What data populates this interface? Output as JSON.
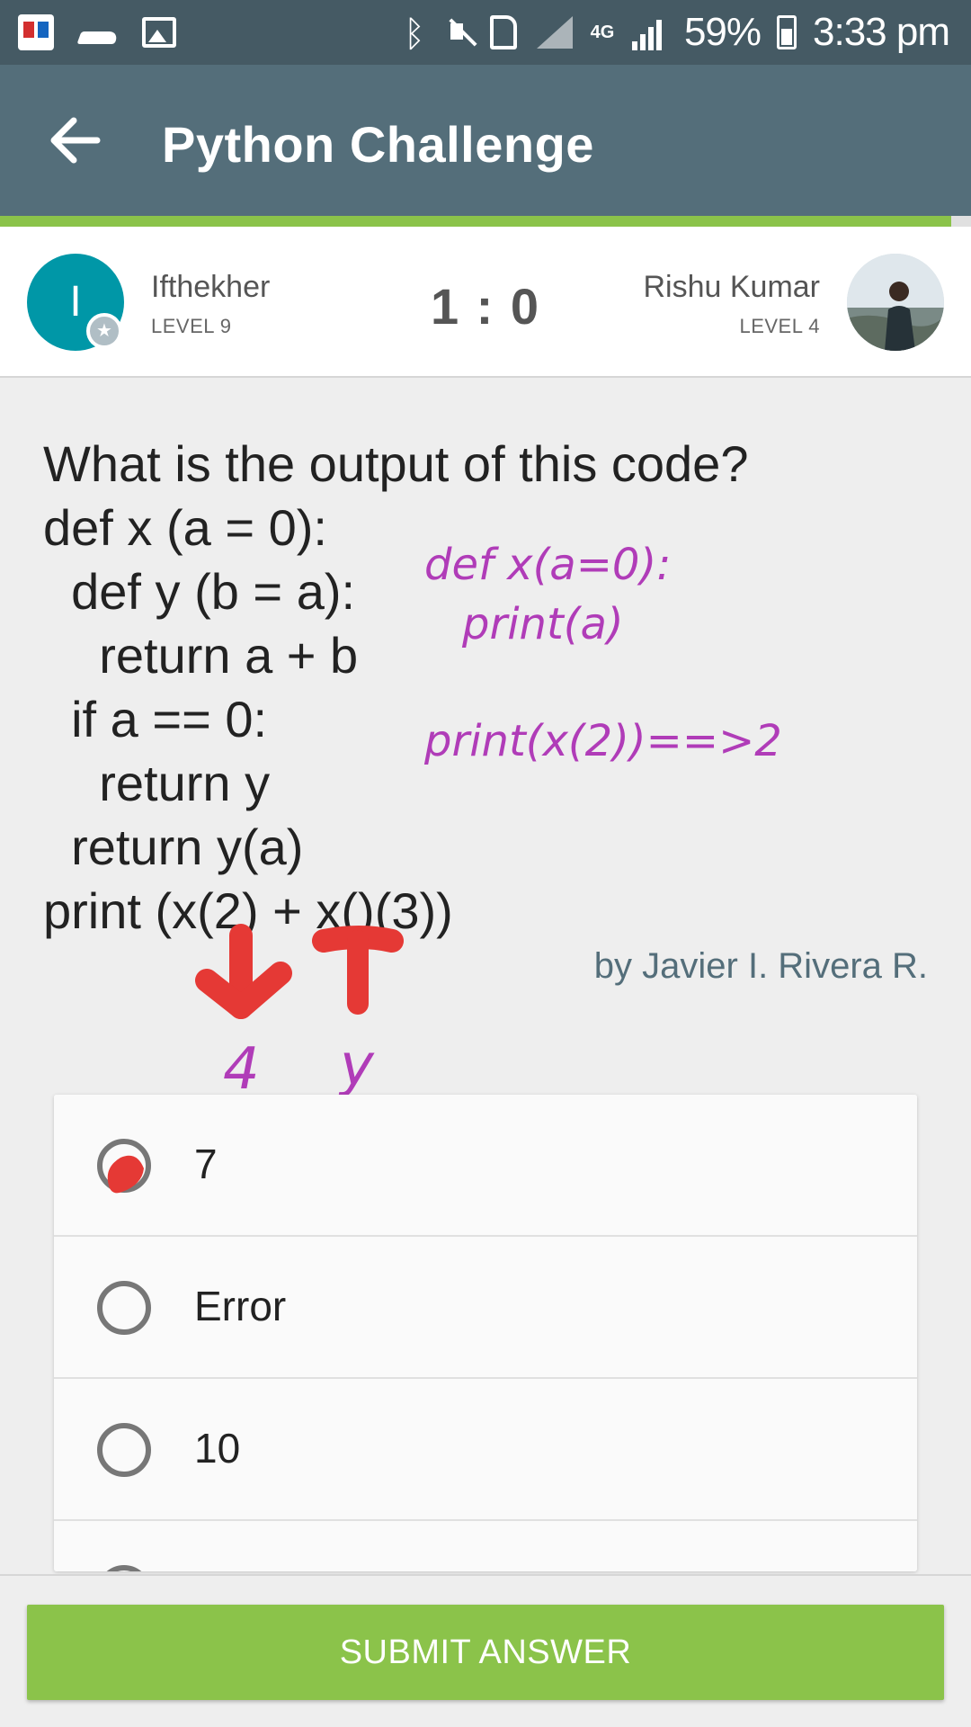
{
  "status_bar": {
    "left_icons": [
      "app-notification-icon",
      "shoe-icon",
      "image-icon"
    ],
    "right_icons": [
      "bluetooth-icon",
      "mute-icon",
      "sim-icon",
      "signal-icon",
      "4g-icon",
      "signal-icon"
    ],
    "network": "4G",
    "battery": "59%",
    "time": "3:33 pm"
  },
  "app_bar": {
    "title": "Python Challenge",
    "back_icon": "arrow-left-icon"
  },
  "progress": {
    "fraction": 0.98,
    "color": "#8bc34a"
  },
  "players": {
    "left": {
      "initial": "I",
      "name": "Ifthekher",
      "level": "LEVEL 9",
      "badge_icon": "star-icon",
      "avatar_color": "#0097a7"
    },
    "score": "1 : 0",
    "right": {
      "name": "Rishu Kumar",
      "level": "LEVEL 4",
      "avatar": "photo-avatar"
    }
  },
  "question": {
    "lines": [
      "What is the output of this code?",
      "def x (a = 0):",
      "  def y (b = a):",
      "    return a + b",
      "  if a == 0:",
      "    return y",
      "  return y(a)",
      "print (x(2) + x()(3))"
    ],
    "author": "by Javier I. Rivera R."
  },
  "annotations": {
    "note1_line1": "def x(a=0):",
    "note1_line2": "print(a)",
    "note2": "print(x(2))==>2",
    "under_left": "4",
    "under_right": "y",
    "ink_purple": "#b03cb8",
    "ink_red": "#e53935"
  },
  "options": [
    {
      "label": "7",
      "marked": true
    },
    {
      "label": "Error",
      "marked": false
    },
    {
      "label": "10",
      "marked": false
    }
  ],
  "submit": {
    "label": "SUBMIT ANSWER",
    "color": "#8bc34a"
  }
}
